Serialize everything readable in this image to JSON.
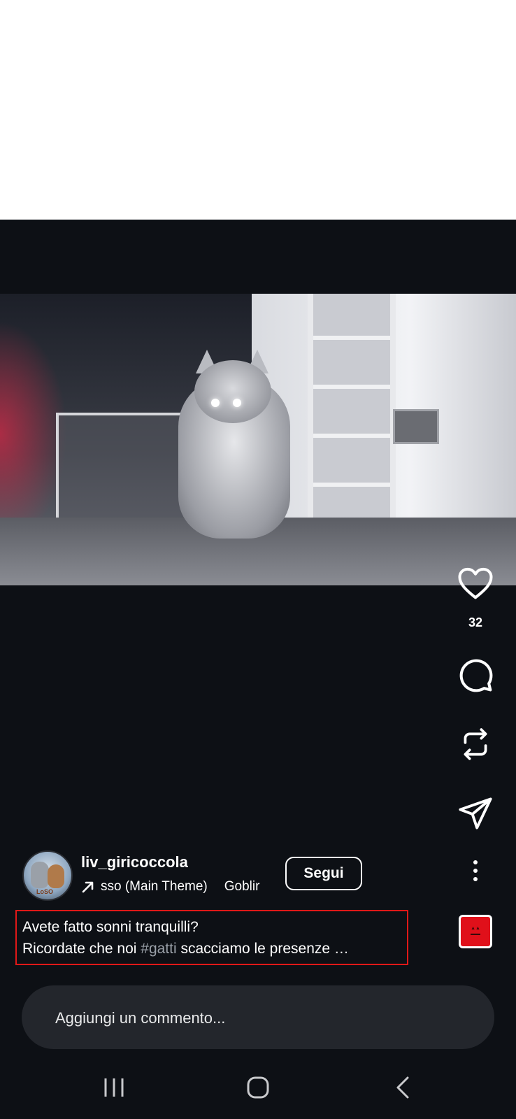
{
  "post": {
    "username": "liv_giricoccola",
    "follow_label": "Segui",
    "music": {
      "track": "sso (Main Theme)",
      "artist": "Goblir"
    },
    "caption_line1": "Avete fatto sonni tranquilli?",
    "caption_line2_pre": "Ricordate che noi ",
    "caption_hashtag": "#gatti",
    "caption_line2_post": " scacciamo le presenze …",
    "avatar_label": "LoSO"
  },
  "actions": {
    "like_count": "32",
    "icons": [
      "heart-icon",
      "comment-icon",
      "repost-icon",
      "send-icon",
      "more-icon"
    ]
  },
  "comment": {
    "placeholder": "Aggiungi un commento..."
  },
  "system_nav": {
    "icons": [
      "recents-icon",
      "home-icon",
      "back-icon"
    ]
  },
  "colors": {
    "background": "#0d1015",
    "caption_border": "#e01818",
    "hashtag": "#9aa0a8",
    "comment_bar": "#23262c"
  }
}
